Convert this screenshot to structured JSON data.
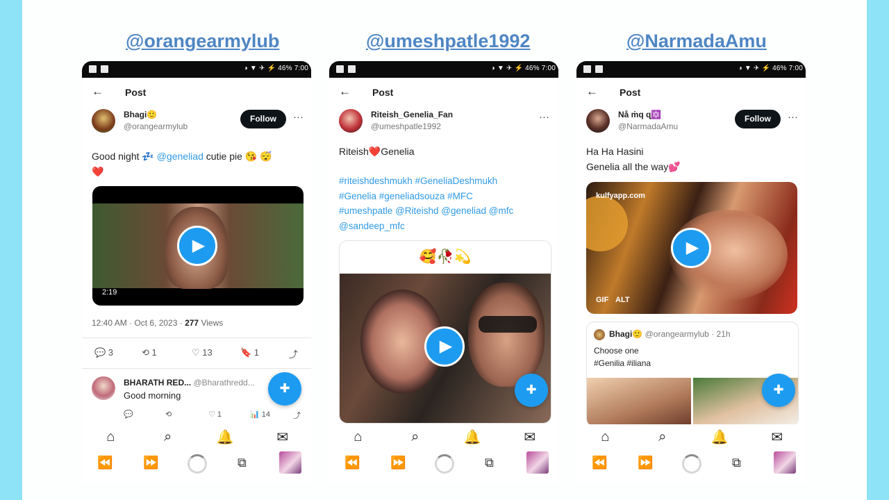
{
  "handles": [
    "@orangearmylub",
    "@umeshpatle1992",
    "@NarmadaAmu"
  ],
  "status": {
    "right": "46% 7:00"
  },
  "header": {
    "back": "←",
    "title": "Post"
  },
  "icons": {
    "tabbar": [
      "home-icon",
      "search-icon",
      "bell-icon",
      "mail-icon"
    ],
    "system": [
      "rewind-icon",
      "forward-icon",
      "loading-spinner",
      "tabs-icon",
      "app-thumbnail"
    ]
  },
  "tabbar_glyphs": [
    "⌂",
    "⌕",
    "🔔",
    "✉"
  ],
  "system_glyphs": [
    "⏪",
    "⏩",
    "⧉"
  ],
  "p1": {
    "name": "Bhagi🙂",
    "handle": "@orangearmylub",
    "follow": "Follow",
    "more": "···",
    "text_a": "Good night 💤",
    "mention": "@geneliad",
    "text_b": " cutie pie 😘 😴",
    "text_c": "❤️",
    "video_label": "2:19",
    "meta_time": "12:40 AM · Oct 6, 2023 · ",
    "meta_views": "277",
    "meta_views_label": " Views",
    "actions": {
      "reply": "💬 3",
      "retweet": "⟲ 1",
      "like": "♡ 13",
      "bookmark": "🔖 1",
      "share": "⤴"
    },
    "reply": {
      "name": "BHARATH RED...",
      "handle": "@Bharathredd...",
      "text": "Good morning",
      "actions": {
        "reply": "💬",
        "retweet": "⟲",
        "like": "♡ 1",
        "views": "📊 14",
        "share": "⤴"
      }
    }
  },
  "p2": {
    "name": "Riteish_Genelia_Fan",
    "handle": "@umeshpatle1992",
    "more": "···",
    "text_a": "Riteish",
    "text_heart": "❤️",
    "text_b": "Genelia",
    "tags": [
      "#riteishdeshmukh #GeneliaDeshmukh",
      "#Genelia #geneliadsouza #MFC",
      "#umeshpatle @Riteishd @geneliad @mfc",
      "@sandeep_mfc"
    ],
    "card_emoji": "🥰🥀💫"
  },
  "p3": {
    "name": "Nå ṁq ɋ🔯",
    "handle": "@NarmadaAmu",
    "follow": "Follow",
    "more": "···",
    "line1": "Ha Ha Hasini",
    "line2": "Genelia all the way💕",
    "watermark": "kulfyapp.com",
    "gif": "GIF",
    "alt": "ALT",
    "quote": {
      "name": "Bhagi🙂",
      "handle": "@orangearmylub · 21h",
      "text1": "Choose one",
      "text2": "#Genilia #iliana"
    }
  },
  "fab_icon": "✚"
}
